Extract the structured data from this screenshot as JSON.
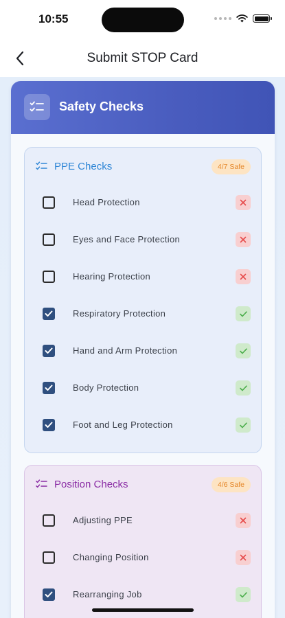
{
  "status_bar": {
    "time": "10:55"
  },
  "nav": {
    "title": "Submit STOP Card"
  },
  "card": {
    "title": "Safety Checks"
  },
  "colors": {
    "header_gradient_start": "#5a6fd0",
    "header_gradient_end": "#4054b6",
    "ppe_accent": "#2f86d6",
    "position_accent": "#8a2ca4",
    "badge_text": "#e5872a",
    "badge_bg": "#fde4c3",
    "unsafe_mark": "#e64c4c",
    "safe_mark": "#4cae4c"
  },
  "sections": [
    {
      "title": "PPE Checks",
      "badge": "4/7 Safe",
      "icon": "checklist-icon",
      "items": [
        {
          "label": "Head Protection",
          "checked": false,
          "status": "unsafe"
        },
        {
          "label": "Eyes and Face Protection",
          "checked": false,
          "status": "unsafe"
        },
        {
          "label": "Hearing Protection",
          "checked": false,
          "status": "unsafe"
        },
        {
          "label": "Respiratory Protection",
          "checked": true,
          "status": "safe"
        },
        {
          "label": "Hand and Arm Protection",
          "checked": true,
          "status": "safe"
        },
        {
          "label": "Body Protection",
          "checked": true,
          "status": "safe"
        },
        {
          "label": "Foot and Leg Protection",
          "checked": true,
          "status": "safe"
        }
      ]
    },
    {
      "title": "Position Checks",
      "badge": "4/6 Safe",
      "icon": "checklist-icon",
      "items": [
        {
          "label": "Adjusting PPE",
          "checked": false,
          "status": "unsafe"
        },
        {
          "label": "Changing Position",
          "checked": false,
          "status": "unsafe"
        },
        {
          "label": "Rearranging Job",
          "checked": true,
          "status": "safe"
        }
      ]
    }
  ]
}
